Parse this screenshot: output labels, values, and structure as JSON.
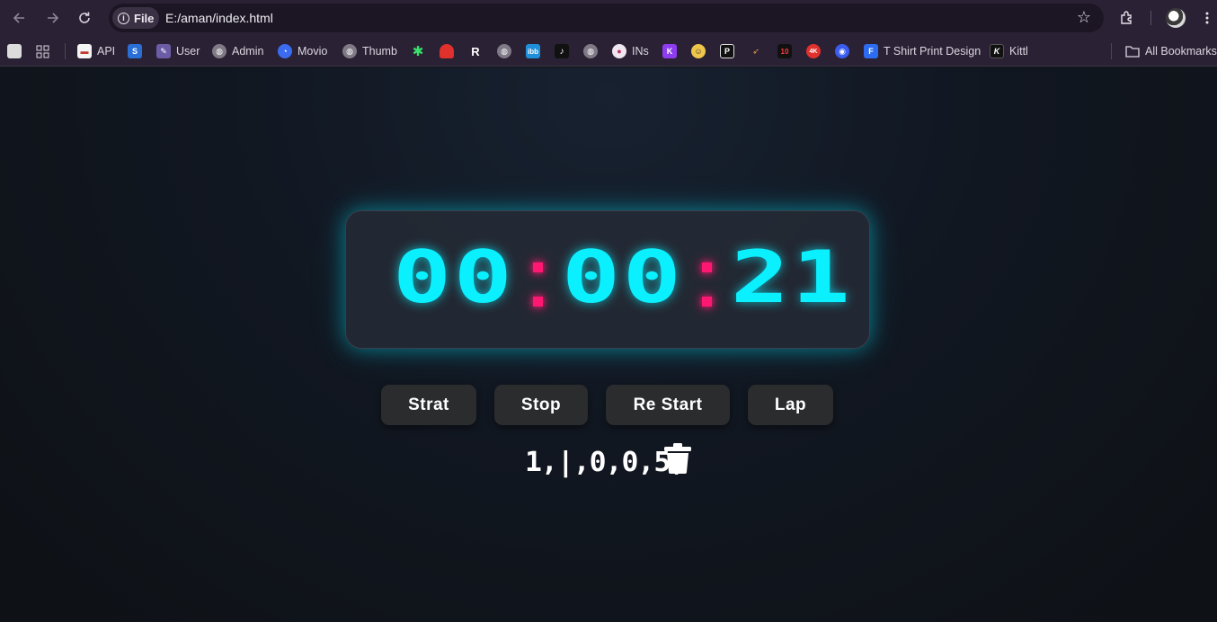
{
  "browser": {
    "url": "E:/aman/index.html",
    "scheme_chip": "File",
    "bookmarks": [
      {
        "label": "API",
        "icon": "api-icon"
      },
      {
        "label": "",
        "icon": "s-icon"
      },
      {
        "label": "User",
        "icon": "user-icon"
      },
      {
        "label": "Admin",
        "icon": "globe-icon"
      },
      {
        "label": "Movio",
        "icon": "movio-icon"
      },
      {
        "label": "Thumb",
        "icon": "globe-icon"
      },
      {
        "label": "T Shirt Print Design",
        "icon": "f-icon"
      },
      {
        "label": "Kittl",
        "icon": "kittl-icon"
      },
      {
        "label": "INs",
        "icon": "ins-icon"
      }
    ],
    "all_bookmarks": "All Bookmarks"
  },
  "stopwatch": {
    "hours": "00",
    "minutes": "00",
    "seconds": "21",
    "digit_color": "#0af0ff",
    "colon_color": "#ff1872"
  },
  "controls": {
    "start_label": "Strat",
    "stop_label": "Stop",
    "restart_label": "Re Start",
    "lap_label": "Lap"
  },
  "laps": {
    "text": "1,|,0,0,5,"
  }
}
